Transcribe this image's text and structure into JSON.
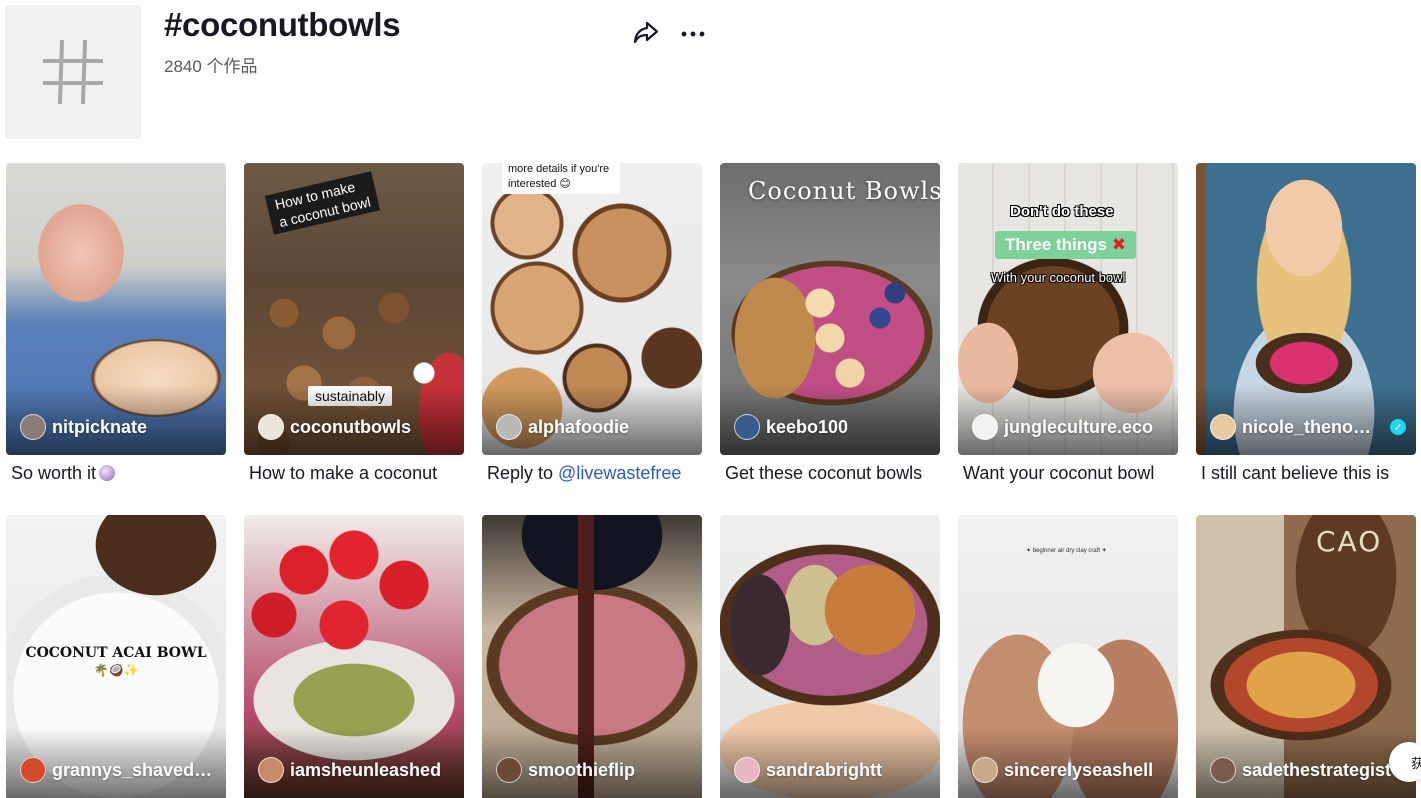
{
  "header": {
    "title": "#coconutbowls",
    "count": "2840 个作品",
    "share_icon": "share-arrow-icon",
    "more_icon": "more-dots-icon"
  },
  "videos": [
    {
      "author": "nitpicknate",
      "caption": "So worth it",
      "caption_emoji": "orb-emoji",
      "avatar_color": "#8a7d74"
    },
    {
      "author": "coconutbowls",
      "caption": "How to make a coconut",
      "overlay_top": "How to make\na coconut bowl",
      "overlay_bottom": "sustainably",
      "avatar_color": "#e9e3d8"
    },
    {
      "author": "alphafoodie",
      "caption_prefix": "Reply to ",
      "caption_mention": "@livewastefree",
      "overlay_note": "more details if you're interested 😊",
      "avatar_color": "#b8b8b8"
    },
    {
      "author": "keebo100",
      "caption": "Get these coconut bowls",
      "overlay_title": "Coconut Bowls",
      "avatar_color": "#3a5a8c"
    },
    {
      "author": "jungleculture.eco",
      "caption": "Want your coconut bowl",
      "overlay_line1": "Don't do these",
      "overlay_badge": "Three things",
      "overlay_badge_mark": "✖",
      "overlay_line2": "With your coconut bowl",
      "avatar_color": "#f2f2f2"
    },
    {
      "author": "nicole_thenom...",
      "caption": "I still cant believe this is",
      "verified": true,
      "avatar_color": "#e8c9a0"
    },
    {
      "author": "grannys_shaved_i...",
      "overlay_title": "COCONUT ACAI BOWL",
      "overlay_emoji": "🌴🥥✨",
      "avatar_color": "#d44a2c"
    },
    {
      "author": "iamsheunleashed",
      "avatar_color": "#c98a6a"
    },
    {
      "author": "smoothieflip",
      "avatar_color": "#6b4a3a"
    },
    {
      "author": "sandrabrightt",
      "avatar_color": "#e7b6c2"
    },
    {
      "author": "sincerelyseashell",
      "overlay_note": "✦ beginner air dry clay craft ✦",
      "avatar_color": "#c9a98a"
    },
    {
      "author": "sadethestrategist",
      "overlay_brand": "CAO",
      "avatar_color": "#7a5a4a"
    }
  ],
  "side_button": {
    "label": "获"
  }
}
